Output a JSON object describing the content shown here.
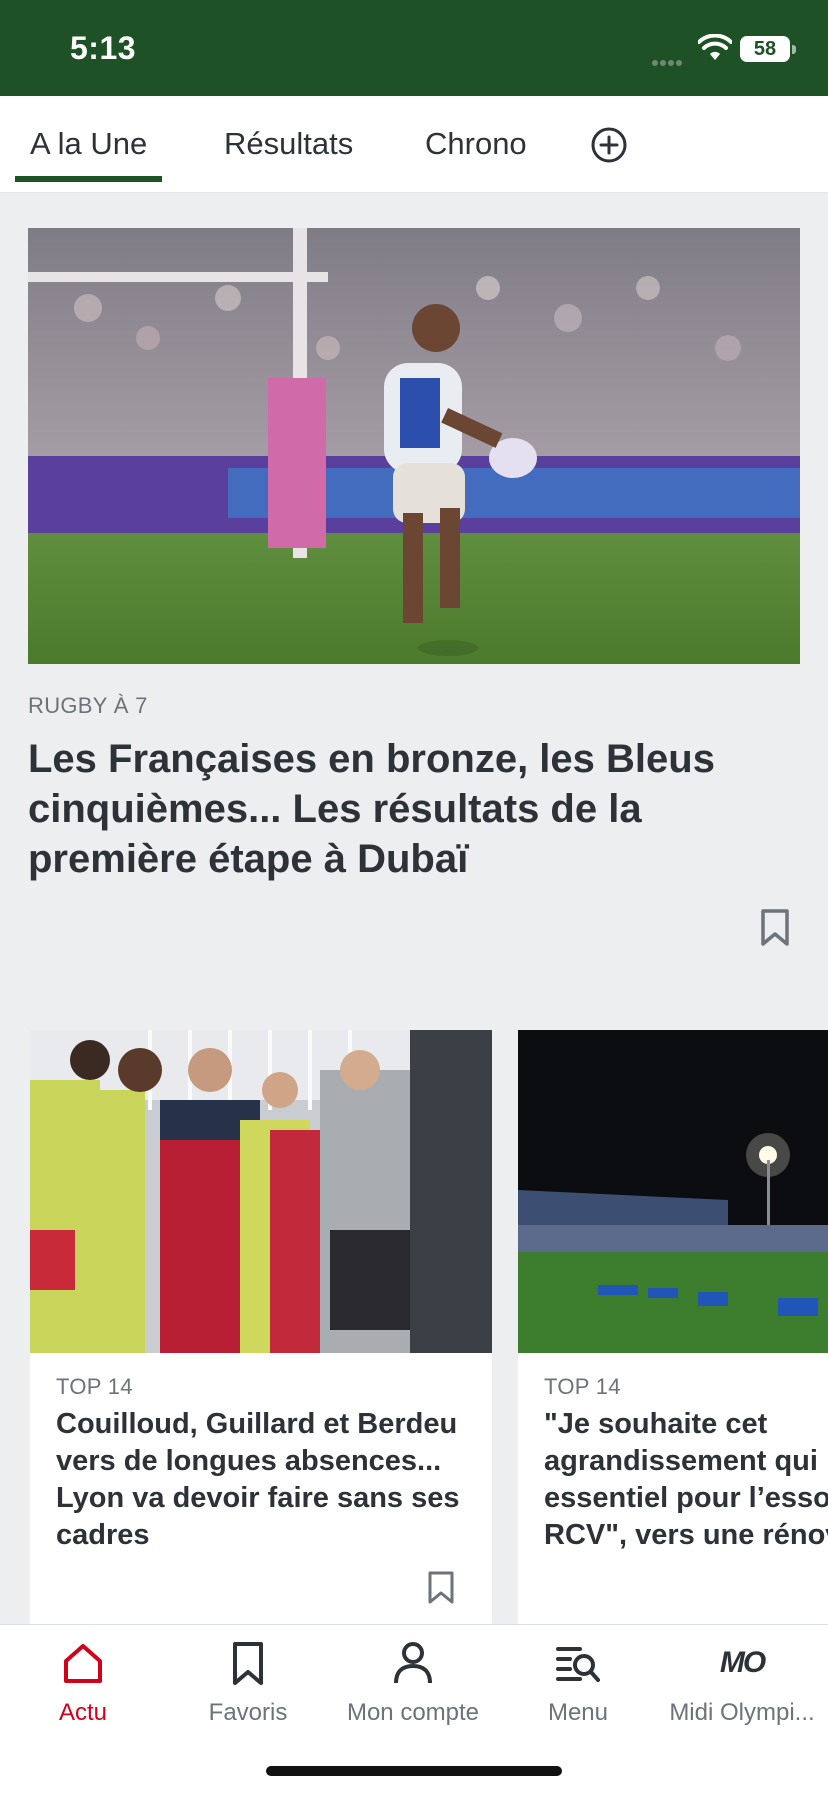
{
  "status_bar": {
    "time": "5:13",
    "battery": "58"
  },
  "tabs": [
    {
      "label": "A la Une",
      "active": true
    },
    {
      "label": "Résultats",
      "active": false
    },
    {
      "label": "Chrono",
      "active": false
    }
  ],
  "hero": {
    "category": "RUGBY À 7",
    "title": "Les Françaises en bronze, les Bleus cinquièmes... Les résultats de la première étape à Dubaï"
  },
  "cards": [
    {
      "category": "TOP 14",
      "title": "Couilloud, Guillard et Berdeu vers de longues absences... Lyon va devoir faire sans ses cadres"
    },
    {
      "category": "TOP 14",
      "title": "\"Je souhaite cet agrandissement qui essentiel pour l'esso RCV\", vers une rénov"
    }
  ],
  "bottom_nav": [
    {
      "label": "Actu",
      "icon": "home-icon",
      "active": true
    },
    {
      "label": "Favoris",
      "icon": "bookmark-icon",
      "active": false
    },
    {
      "label": "Mon compte",
      "icon": "person-icon",
      "active": false
    },
    {
      "label": "Menu",
      "icon": "menu-search-icon",
      "active": false
    },
    {
      "label": "Midi Olympi...",
      "icon": "mo-logo-icon",
      "active": false,
      "logo_text": "MO"
    }
  ],
  "colors": {
    "brand_green": "#1e5126",
    "accent_red": "#d0021b"
  }
}
